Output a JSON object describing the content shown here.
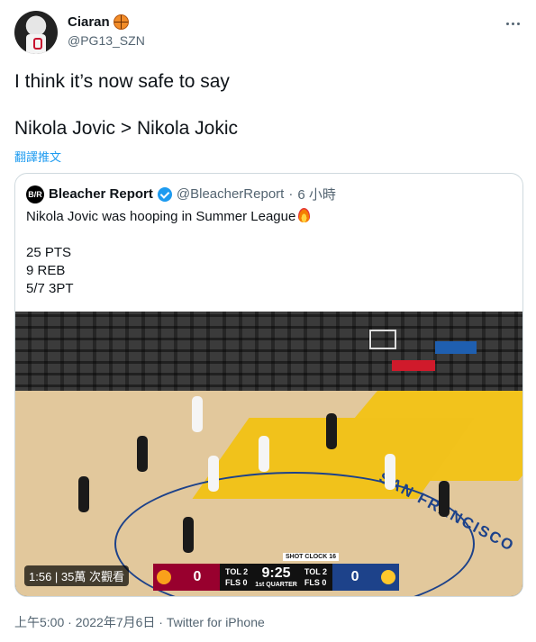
{
  "author": {
    "display_name": "Ciaran",
    "handle": "@PG13_SZN",
    "badge_icon": "basketball-icon",
    "avatar_jersey_number": "13"
  },
  "tweet": {
    "lines": [
      "I think it’s now safe to say",
      "Nikola Jovic > Nikola Jokic"
    ],
    "translate_label": "翻譯推文"
  },
  "quote": {
    "logo_text": "B/R",
    "display_name": "Bleacher Report",
    "handle": "@BleacherReport",
    "separator": "·",
    "time": "6 小時",
    "text_line": "Nikola Jovic was hooping in Summer League",
    "stats": [
      "25 PTS",
      "9 REB",
      "5/7 3PT"
    ]
  },
  "media": {
    "duration": "1:56",
    "views": "35萬 次觀看",
    "court_text": "SAN FRANCISCO",
    "scoreboard": {
      "home_score": "0",
      "away_score": "0",
      "clock": "9:25",
      "quarter": "1st QUARTER",
      "shot_clock_label": "SHOT CLOCK",
      "shot_clock": "16",
      "tol_left": "TOL 2",
      "fls_left": "FLS 0",
      "tol_right": "TOL 2",
      "fls_right": "FLS 0",
      "home_color": "#98002e",
      "away_color": "#1d428a"
    }
  },
  "footer": {
    "time": "上午5:00",
    "date": "2022年7月6日",
    "source": "Twitter for iPhone",
    "text": "上午5:00 · 2022年7月6日 · Twitter for iPhone"
  },
  "colors": {
    "link": "#1d9bf0",
    "muted": "#536471",
    "border": "#cfd9de"
  }
}
